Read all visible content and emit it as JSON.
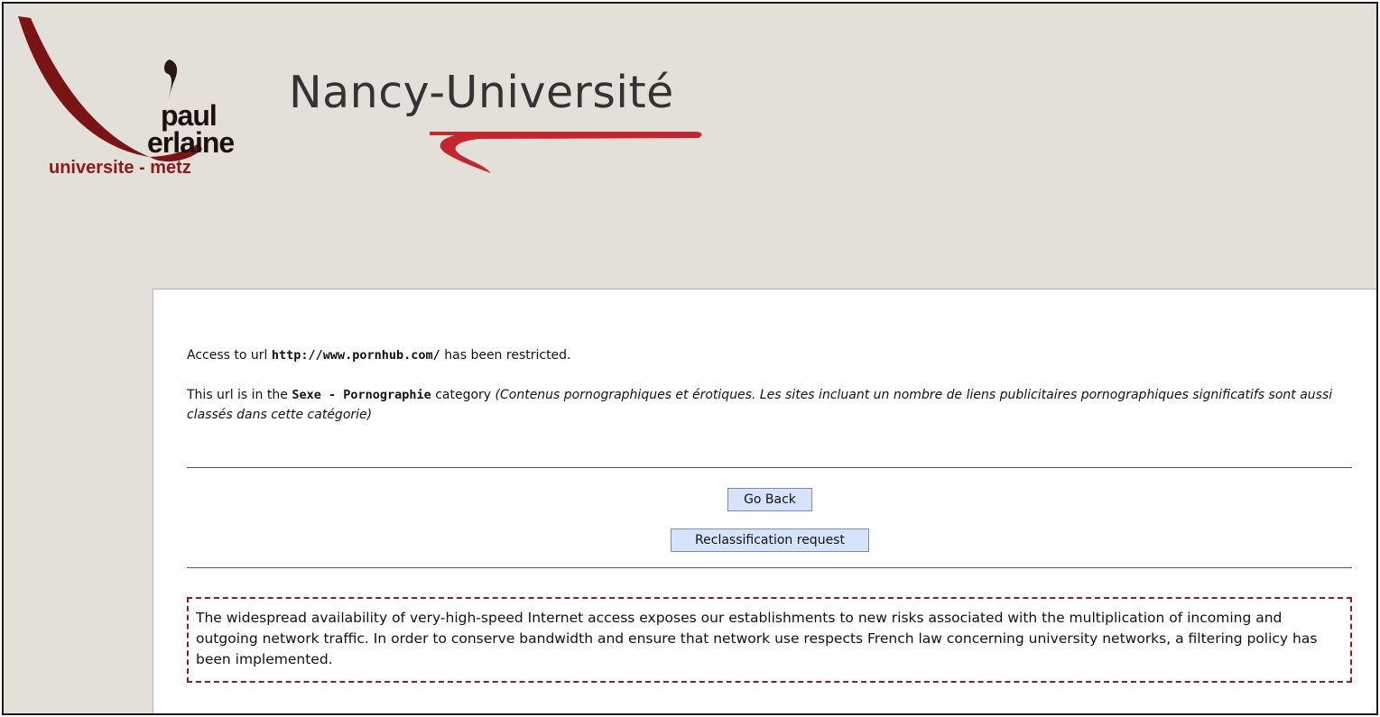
{
  "header": {
    "logo_left": {
      "line1": "paul",
      "line2": "erlaine",
      "line3": "universite - metz"
    },
    "logo_right": {
      "wordmark": "Nancy-Université"
    },
    "colors": {
      "brand_red": "#8e1a1a",
      "wordmark_grey": "#333333",
      "background": "#e3dfd9"
    }
  },
  "message": {
    "access_prefix": "Access to url",
    "url": "http://www.pornhub.com/",
    "access_suffix": "has been restricted.",
    "category_prefix": "This url is in the",
    "category_name": "Sexe - Pornographie",
    "category_word": "category",
    "category_description": "(Contenus pornographiques et érotiques. Les sites incluant un nombre de liens publicitaires pornographiques significatifs sont aussi classés dans cette catégorie)"
  },
  "buttons": {
    "go_back": "Go Back",
    "reclassification": "Reclassification request"
  },
  "notice": {
    "text": "The widespread availability of very-high-speed Internet access exposes our establishments to new risks associated with the multiplication of incoming and outgoing network traffic. In order to conserve bandwidth and ensure that network use respects French law concerning university networks, a filtering policy has been implemented."
  }
}
